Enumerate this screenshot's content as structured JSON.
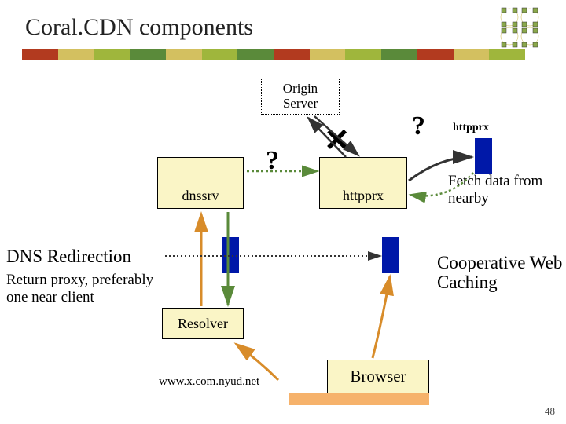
{
  "title": "Coral.CDN components",
  "stripe_colors": [
    "#b23a1f",
    "#d3c060",
    "#9fb63c",
    "#5a8a3a",
    "#d3c060",
    "#9fb63c",
    "#5a8a3a",
    "#b23a1f",
    "#d3c060",
    "#9fb63c",
    "#5a8a3a",
    "#b23a1f",
    "#d3c060",
    "#9fb63c"
  ],
  "boxes": {
    "origin": "Origin\nServer",
    "dnssrv": "dnssrv",
    "httpprx": "httpprx",
    "resolver": "Resolver",
    "browser": "Browser"
  },
  "labels": {
    "httpprx_small": "httpprx",
    "q1": "?",
    "q2": "?"
  },
  "text": {
    "dns_title": "DNS Redirection",
    "dns_desc": "Return proxy, preferably one near client",
    "coop_title": "Cooperative Web Caching",
    "fetch": "Fetch data from nearby",
    "url": "www.x.com.nyud.net"
  },
  "slide_number": "48"
}
